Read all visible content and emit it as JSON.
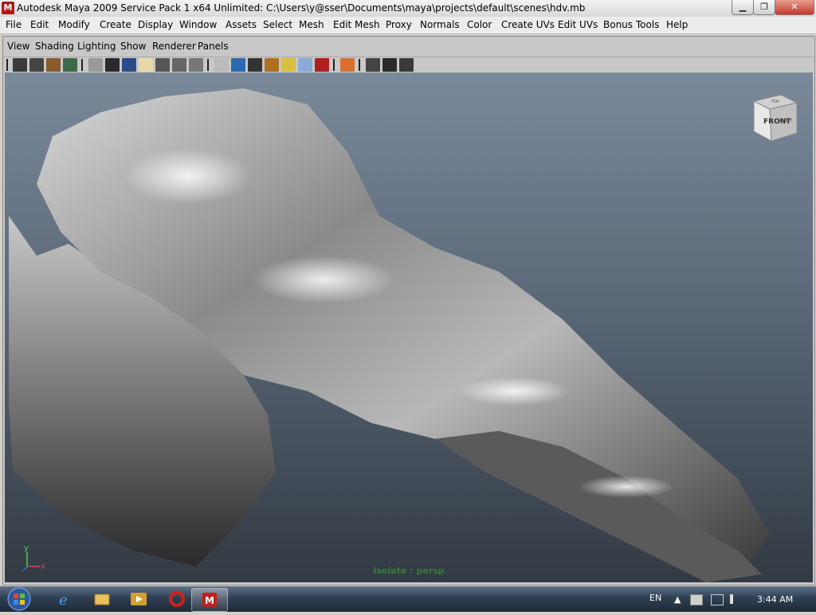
{
  "window": {
    "title": "Autodesk Maya 2009 Service Pack 1 x64 Unlimited: C:\\Users\\y@sser\\Documents\\maya\\projects\\default\\scenes\\hdv.mb",
    "app_icon": "maya-logo-icon",
    "minimize_glyph": "▁",
    "maximize_glyph": "❐",
    "close_glyph": "✕"
  },
  "main_menu": [
    "File",
    "Edit",
    "Modify",
    "Create",
    "Display",
    "Window",
    "Assets",
    "Select",
    "Mesh",
    "Edit Mesh",
    "Proxy",
    "Normals",
    "Color",
    "Create UVs",
    "Edit UVs",
    "Bonus Tools",
    "Help"
  ],
  "panel_menu": [
    "View",
    "Shading",
    "Lighting",
    "Show",
    "Renderer",
    "Panels"
  ],
  "toolbar_icons": [
    "select-camera-icon",
    "lock-camera-icon",
    "bookmarks-icon",
    "image-plane-icon",
    "grid-icon",
    "film-gate-icon",
    "resolution-gate-icon",
    "gate-mask-icon",
    "field-chart-icon",
    "safe-action-icon",
    "safe-title-icon",
    "wireframe-icon",
    "smooth-shade-icon",
    "wireframe-on-shaded-icon",
    "textured-icon",
    "use-lights-icon",
    "xray-icon",
    "isolate-select-icon",
    "hud-icon",
    "shadows-icon",
    "frame-all-icon",
    "frame-selected-icon"
  ],
  "viewcube": {
    "front": "FRONT",
    "top": "TOP",
    "right": "RIGHT"
  },
  "viewport": {
    "isolate_label": "Isolate : persp",
    "axis_y": "y",
    "axis_x": "x"
  },
  "taskbar": {
    "start": "windows-orb-icon",
    "apps": [
      "internet-explorer-icon",
      "file-explorer-icon",
      "media-player-icon",
      "opera-icon",
      "maya-icon"
    ],
    "language": "EN",
    "tray_up": "▲",
    "clock": "3:44 AM"
  }
}
